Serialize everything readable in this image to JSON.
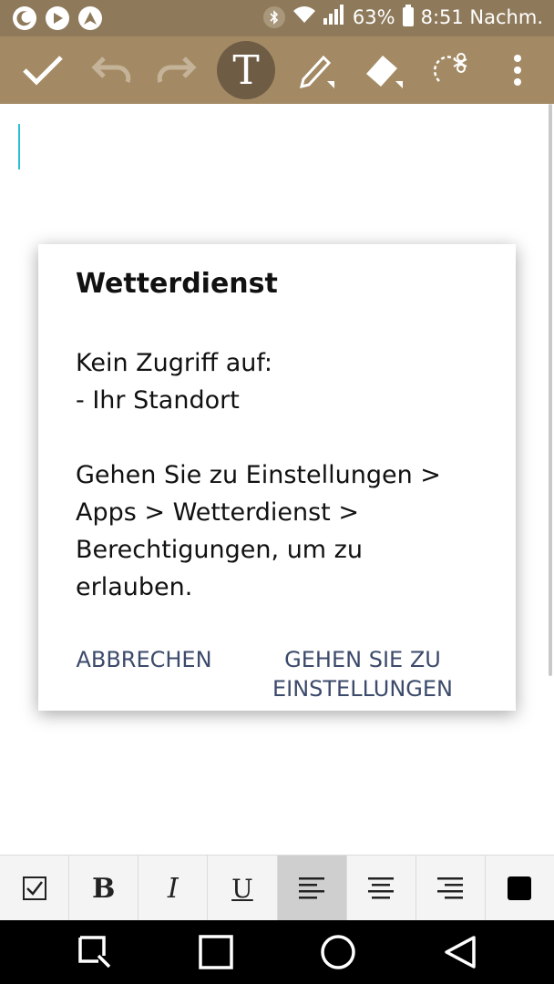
{
  "status_bar": {
    "battery_percent": "63%",
    "time": "8:51 Nachm.",
    "left_icons": [
      "moon-icon",
      "play-icon",
      "nav-arrow-icon"
    ],
    "right_icons": [
      "bluetooth-icon",
      "wifi-icon",
      "signal-icon",
      "battery-icon"
    ]
  },
  "toolbar": {
    "items": [
      "check-icon",
      "undo-icon",
      "redo-icon",
      "text-tool-icon",
      "pen-icon",
      "eraser-icon",
      "lasso-icon",
      "more-icon"
    ],
    "text_tool_label": "T"
  },
  "dialog": {
    "title": "Wetterdienst",
    "message": "Kein Zugriff auf:\n- Ihr Standort\n\nGehen Sie zu Einstellungen > Apps > Wetterdienst > Berechtigungen, um zu erlauben.",
    "cancel_label": "ABBRECHEN",
    "settings_label": "GEHEN SIE ZU\nEINSTELLUNGEN"
  },
  "format_bar": {
    "bold_label": "B",
    "italic_label": "I",
    "underline_label": "U",
    "items": [
      "checkbox-icon",
      "bold-icon",
      "italic-icon",
      "underline-icon",
      "align-left-icon",
      "align-center-icon",
      "align-right-icon",
      "color-swatch-icon"
    ],
    "active": "align-left-icon",
    "text_color": "#000000"
  },
  "nav_bar": {
    "items": [
      "recent-apps-icon",
      "overview-icon",
      "home-icon",
      "back-icon"
    ]
  },
  "colors": {
    "status_bar": "#8e7a5b",
    "toolbar": "#a38a64",
    "cursor": "#2bc0cf",
    "dialog_button": "#3c4a6b"
  }
}
